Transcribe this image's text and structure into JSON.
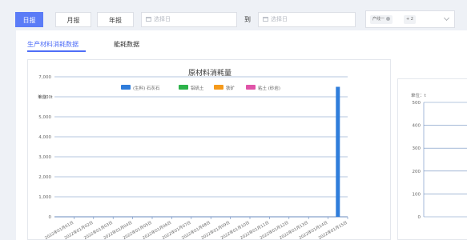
{
  "toolbar": {
    "report_tabs": [
      "日报",
      "月报",
      "年报"
    ],
    "start_date_placeholder": "选择日",
    "to_label": "到",
    "end_date_placeholder": "选择日",
    "product_select": {
      "tag": "产线一",
      "more_tag": "+ 2"
    }
  },
  "tabs": [
    {
      "label": "生产材料消耗数据",
      "active": true
    },
    {
      "label": "能耗数据",
      "active": false
    }
  ],
  "colors": {
    "accent": "#5b7cf7",
    "tab_active": "#4f6ef7",
    "bar": "#2f7ddb"
  },
  "chart_data": [
    {
      "type": "bar",
      "title": "原材料消耗量",
      "unit_label": "单位：t",
      "legend": [
        {
          "name": "(生料) 石灰石",
          "color": "#2f7ddb"
        },
        {
          "name": "铝矾土",
          "color": "#2cb34a"
        },
        {
          "name": "铁矿",
          "color": "#f59a1b"
        },
        {
          "name": "粘土 (砂岩)",
          "color": "#e054a8"
        }
      ],
      "yticks": [
        "7,000",
        "6,000",
        "5,000",
        "4,000",
        "3,000",
        "2,000",
        "1,000",
        "0"
      ],
      "ylim": [
        0,
        7000
      ],
      "categories": [
        "2022年01月01日",
        "2022年01月02日",
        "2022年01月03日",
        "2022年01月04日",
        "2022年01月05日",
        "2022年01月06日",
        "2022年01月07日",
        "2022年01月08日",
        "2022年01月09日",
        "2022年01月10日",
        "2022年01月11日",
        "2022年01月12日",
        "2022年01月13日",
        "2022年01月14日",
        "2022年01月15日"
      ],
      "series": [
        {
          "name": "(生料) 石灰石",
          "values": [
            0,
            0,
            0,
            0,
            0,
            0,
            0,
            0,
            0,
            0,
            0,
            0,
            0,
            0,
            6500
          ]
        }
      ]
    },
    {
      "type": "bar",
      "unit_label": "单位：t",
      "yticks": [
        "500",
        "400",
        "300",
        "200",
        "100",
        "0"
      ],
      "ylim": [
        0,
        500
      ]
    }
  ]
}
